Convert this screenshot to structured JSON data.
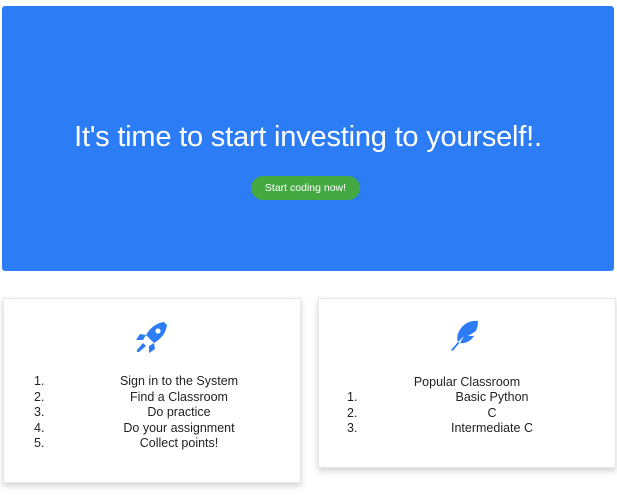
{
  "hero": {
    "title": "It's time to start investing to yourself!.",
    "button_label": "Start coding now!",
    "background_color": "#2b7cf5",
    "button_color": "#45a942"
  },
  "steps_card": {
    "icon": "rocket-icon",
    "items": [
      {
        "number": "1.",
        "label": "Sign in to the System"
      },
      {
        "number": "2.",
        "label": "Find a Classroom"
      },
      {
        "number": "3.",
        "label": "Do practice"
      },
      {
        "number": "4.",
        "label": "Do your assignment"
      },
      {
        "number": "5.",
        "label": "Collect points!"
      }
    ]
  },
  "popular_card": {
    "icon": "feather-icon",
    "title": "Popular Classroom",
    "items": [
      {
        "number": "1.",
        "label": "Basic Python"
      },
      {
        "number": "2.",
        "label": "C"
      },
      {
        "number": "3.",
        "label": "Intermediate C"
      }
    ]
  }
}
